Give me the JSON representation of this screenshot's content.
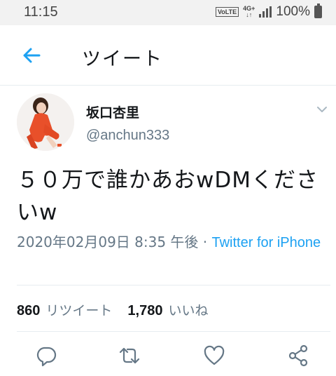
{
  "status_bar": {
    "time": "11:15",
    "volte": "VoLTE",
    "network": "4G+",
    "battery": "100%"
  },
  "header": {
    "title": "ツイート",
    "back_icon": "arrow-left-icon"
  },
  "tweet": {
    "display_name": "坂口杏里",
    "handle": "@anchun333",
    "text": "５０万で誰かあおwDMくださいw",
    "timestamp": "2020年02月09日 8:35 午後 · ",
    "source": "Twitter for iPhone",
    "retweets_count": "860",
    "retweets_label": "リツイート",
    "likes_count": "1,780",
    "likes_label": "いいね"
  },
  "actions": [
    "reply-icon",
    "retweet-icon",
    "heart-icon",
    "share-icon"
  ],
  "colors": {
    "accent": "#1da1f2",
    "secondary_text": "#657786",
    "primary_text": "#14171a",
    "divider": "#e6ecf0"
  }
}
